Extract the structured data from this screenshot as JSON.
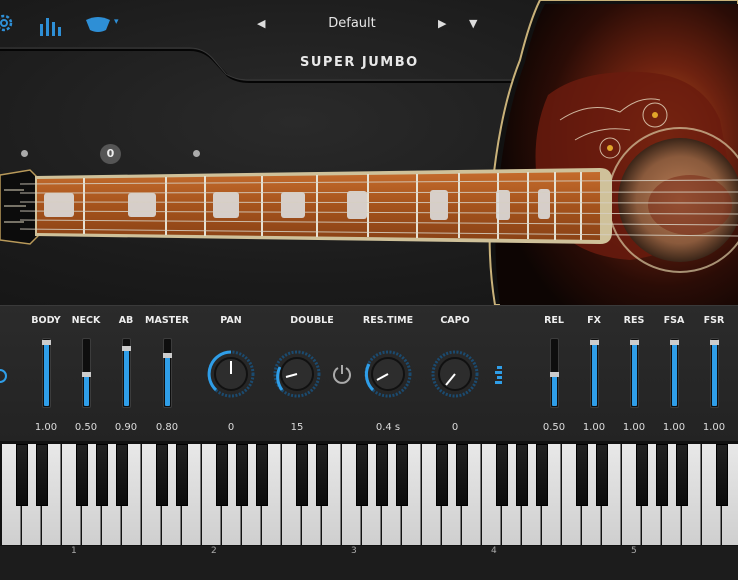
{
  "header": {
    "preset_name": "Default",
    "logo_text": "SUPER JUMBO",
    "icons": [
      "gear-icon",
      "bars-icon",
      "hat-icon",
      "chevron-down-icon",
      "prev-arrow-icon",
      "next-arrow-icon",
      "dropdown-triangle-icon"
    ]
  },
  "strings": {
    "selected_string": "0"
  },
  "controls": {
    "left_sliders": [
      {
        "label": "BODY",
        "value": "1.00",
        "level": 1.0
      },
      {
        "label": "NECK",
        "value": "0.50",
        "level": 0.5
      },
      {
        "label": "AB",
        "value": "0.90",
        "level": 0.9
      },
      {
        "label": "MASTER",
        "value": "0.80",
        "level": 0.8
      }
    ],
    "knobs": [
      {
        "label": "PAN",
        "value": "0"
      },
      {
        "label": "DOUBLE",
        "value": "15"
      },
      {
        "label": "RES.TIME",
        "value": "0.4 s"
      },
      {
        "label": "CAPO",
        "value": "0"
      }
    ],
    "right_sliders": [
      {
        "label": "REL",
        "value": "0.50",
        "level": 0.5
      },
      {
        "label": "FX",
        "value": "1.00",
        "level": 1.0
      },
      {
        "label": "RES",
        "value": "1.00",
        "level": 1.0
      },
      {
        "label": "FSA",
        "value": "1.00",
        "level": 1.0
      },
      {
        "label": "FSR",
        "value": "1.00",
        "level": 1.0
      }
    ]
  },
  "keyboard": {
    "octave_labels": [
      "1",
      "2",
      "3",
      "4",
      "5"
    ]
  },
  "colors": {
    "accent": "#2f9ee8",
    "background": "#1a1a1a"
  }
}
